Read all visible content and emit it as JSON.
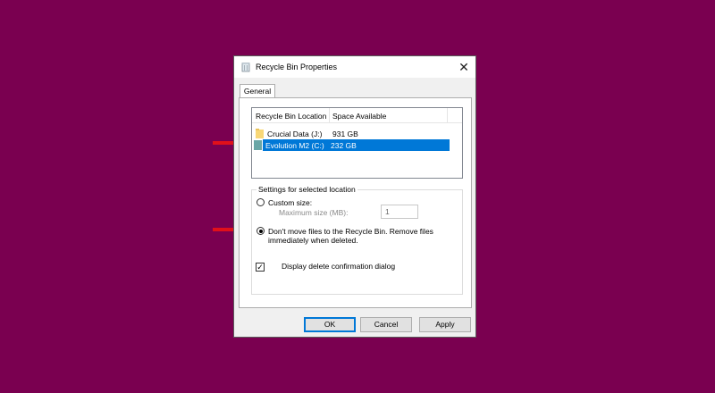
{
  "window": {
    "title": "Recycle Bin Properties",
    "close_glyph": "✕"
  },
  "tabs": [
    {
      "label": "General"
    }
  ],
  "list": {
    "headers": [
      "Recycle Bin Location",
      "Space Available"
    ],
    "rows": [
      {
        "name": "Crucial Data (J:)",
        "space": "931 GB",
        "selected": false,
        "icon": "folder-icon"
      },
      {
        "name": "Evolution M2 (C:)",
        "space": "232 GB",
        "selected": true,
        "icon": "drive-icon"
      }
    ]
  },
  "settings": {
    "group_label": "Settings for selected location",
    "custom_size_label": "Custom size:",
    "max_size_label": "Maximum size (MB):",
    "max_size_value": "1",
    "dont_move_line1": "Don't move files to the Recycle Bin. Remove files",
    "dont_move_line2": "immediately when deleted.",
    "selected_option": "dont_move"
  },
  "confirm": {
    "label": "Display delete confirmation dialog",
    "checked": true,
    "check_glyph": "✓"
  },
  "buttons": {
    "ok": "OK",
    "cancel": "Cancel",
    "apply": "Apply"
  },
  "colors": {
    "background": "#7a0050",
    "selection": "#0078d7",
    "arrow": "#e0101a"
  }
}
